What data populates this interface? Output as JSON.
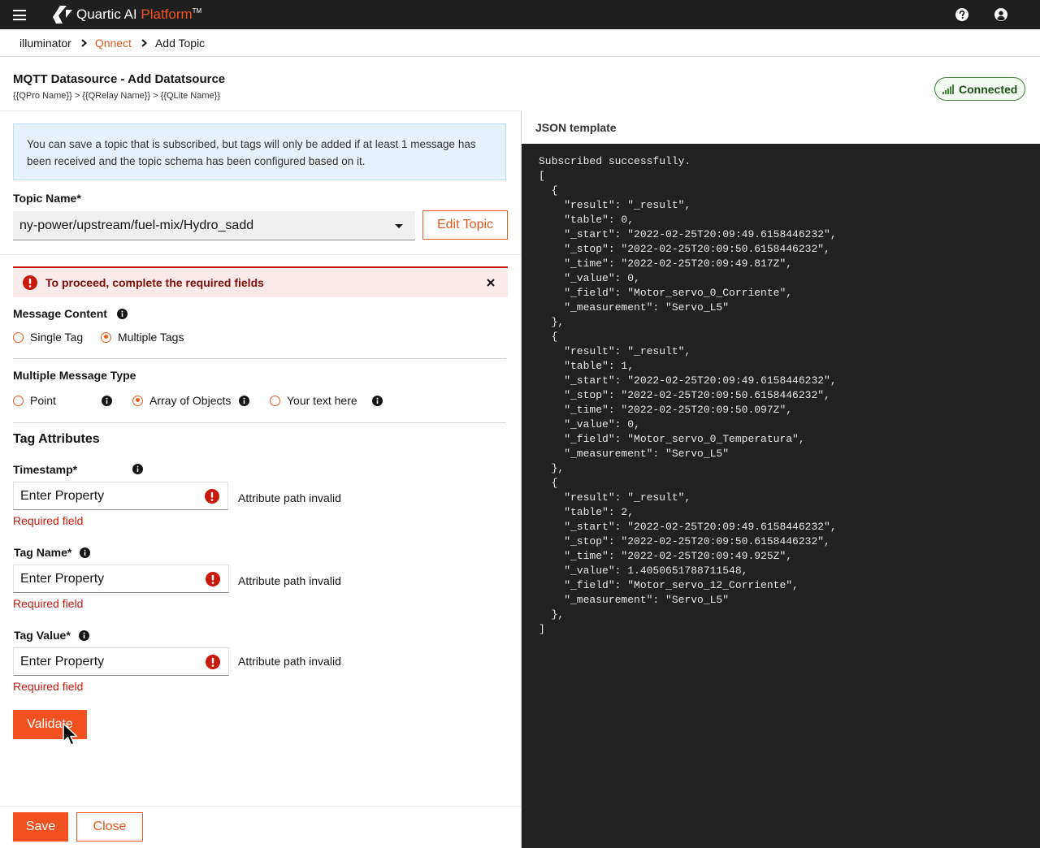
{
  "app": {
    "brand_name": "Quartic AI",
    "brand_accent": "Platform",
    "brand_tm": "TM",
    "accent_color": "#f0511e",
    "topbar_color": "#1f1f1f"
  },
  "topbar": {
    "menu_icon": "hamburger-icon",
    "help_icon": "help-icon",
    "user_icon": "user-icon"
  },
  "breadcrumb": [
    "illuminator",
    "Qnnect",
    "Add Topic"
  ],
  "header": {
    "title": "MQTT Datasource - Add Datatsource",
    "subpath": "{{QPro Name}} > {{QRelay Name}} > {{QLite Name}}",
    "status": "Connected",
    "status_color": "#3e8635"
  },
  "info_alert": {
    "text": "You can save a topic that is subscribed, but tags will only be added if at least 1 message has been received and the topic schema has been configured based on it."
  },
  "topic": {
    "label": "Topic Name*",
    "value": "ny-power/upstream/fuel-mix/Hydro_sadd",
    "edit_button": "Edit Topic"
  },
  "error_alert": {
    "text": "To proceed, complete the required fields"
  },
  "message_content": {
    "label": "Message Content",
    "options": [
      "Single Tag",
      "Multiple Tags"
    ],
    "selected": "Multiple Tags"
  },
  "message_type": {
    "label": "Multiple Message Type",
    "options": [
      "Point",
      "Array of Objects",
      "Your text here"
    ],
    "selected": "Array of Objects"
  },
  "tag_attributes": {
    "title": "Tag Attributes",
    "fields": [
      {
        "label": "Timestamp*",
        "placeholder": "Enter Property",
        "hint": "Attribute path invalid",
        "error": "Required field"
      },
      {
        "label": "Tag Name*",
        "placeholder": "Enter Property",
        "hint": "Attribute path invalid",
        "error": "Required field"
      },
      {
        "label": "Tag Value*",
        "placeholder": "Enter Property",
        "hint": "Attribute path invalid",
        "error": "Required field"
      }
    ],
    "validate_button": "Validate"
  },
  "footer": {
    "save_button": "Save",
    "close_button": "Close"
  },
  "json_template": {
    "title": "JSON template",
    "content": "Subscribed successfully.\n[\n  {\n    \"result\": \"_result\",\n    \"table\": 0,\n    \"_start\": \"2022-02-25T20:09:49.6158446232\",\n    \"_stop\": \"2022-02-25T20:09:50.6158446232\",\n    \"_time\": \"2022-02-25T20:09:49.817Z\",\n    \"_value\": 0,\n    \"_field\": \"Motor_servo_0_Corriente\",\n    \"_measurement\": \"Servo_L5\"\n  },\n  {\n    \"result\": \"_result\",\n    \"table\": 1,\n    \"_start\": \"2022-02-25T20:09:49.6158446232\",\n    \"_stop\": \"2022-02-25T20:09:50.6158446232\",\n    \"_time\": \"2022-02-25T20:09:50.097Z\",\n    \"_value\": 0,\n    \"_field\": \"Motor_servo_0_Temperatura\",\n    \"_measurement\": \"Servo_L5\"\n  },\n  {\n    \"result\": \"_result\",\n    \"table\": 2,\n    \"_start\": \"2022-02-25T20:09:49.6158446232\",\n    \"_stop\": \"2022-02-25T20:09:50.6158446232\",\n    \"_time\": \"2022-02-25T20:09:49.925Z\",\n    \"_value\": 1.4050651788711548,\n    \"_field\": \"Motor_servo_12_Corriente\",\n    \"_measurement\": \"Servo_L5\"\n  },\n]"
  }
}
